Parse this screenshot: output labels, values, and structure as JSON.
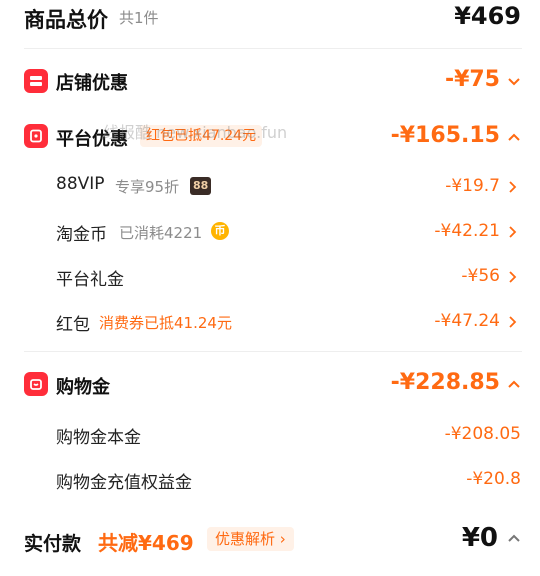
{
  "header": {
    "title": "商品总价",
    "count": "共1件",
    "total": "¥469"
  },
  "shop_discount": {
    "label": "店铺优惠",
    "amount": "-¥75"
  },
  "platform_discount": {
    "label": "平台优惠",
    "tag": "红包已抵47.24元",
    "amount": "-¥165.15",
    "items": [
      {
        "label": "88VIP",
        "note": "专享95折",
        "badge": "88",
        "amount": "-¥19.7"
      },
      {
        "label": "淘金币",
        "note": "已消耗4221",
        "badge": "币",
        "amount": "-¥42.21"
      },
      {
        "label": "平台礼金",
        "note": "",
        "amount": "-¥56"
      },
      {
        "label": "红包",
        "note": "消费券已抵41.24元",
        "amount": "-¥47.24"
      }
    ]
  },
  "watermark": "线报酷 new.xianbao.fun",
  "shopping_gold": {
    "label": "购物金",
    "amount": "-¥228.85",
    "items": [
      {
        "label": "购物金本金",
        "amount": "-¥208.05"
      },
      {
        "label": "购物金充值权益金",
        "amount": "-¥20.8"
      }
    ]
  },
  "footer": {
    "label": "实付款",
    "saved": "共减¥469",
    "analysis": "优惠解析",
    "pay": "¥0"
  },
  "colors": {
    "accent": "#ff6a12",
    "badge_red": "#ff2d3a"
  }
}
